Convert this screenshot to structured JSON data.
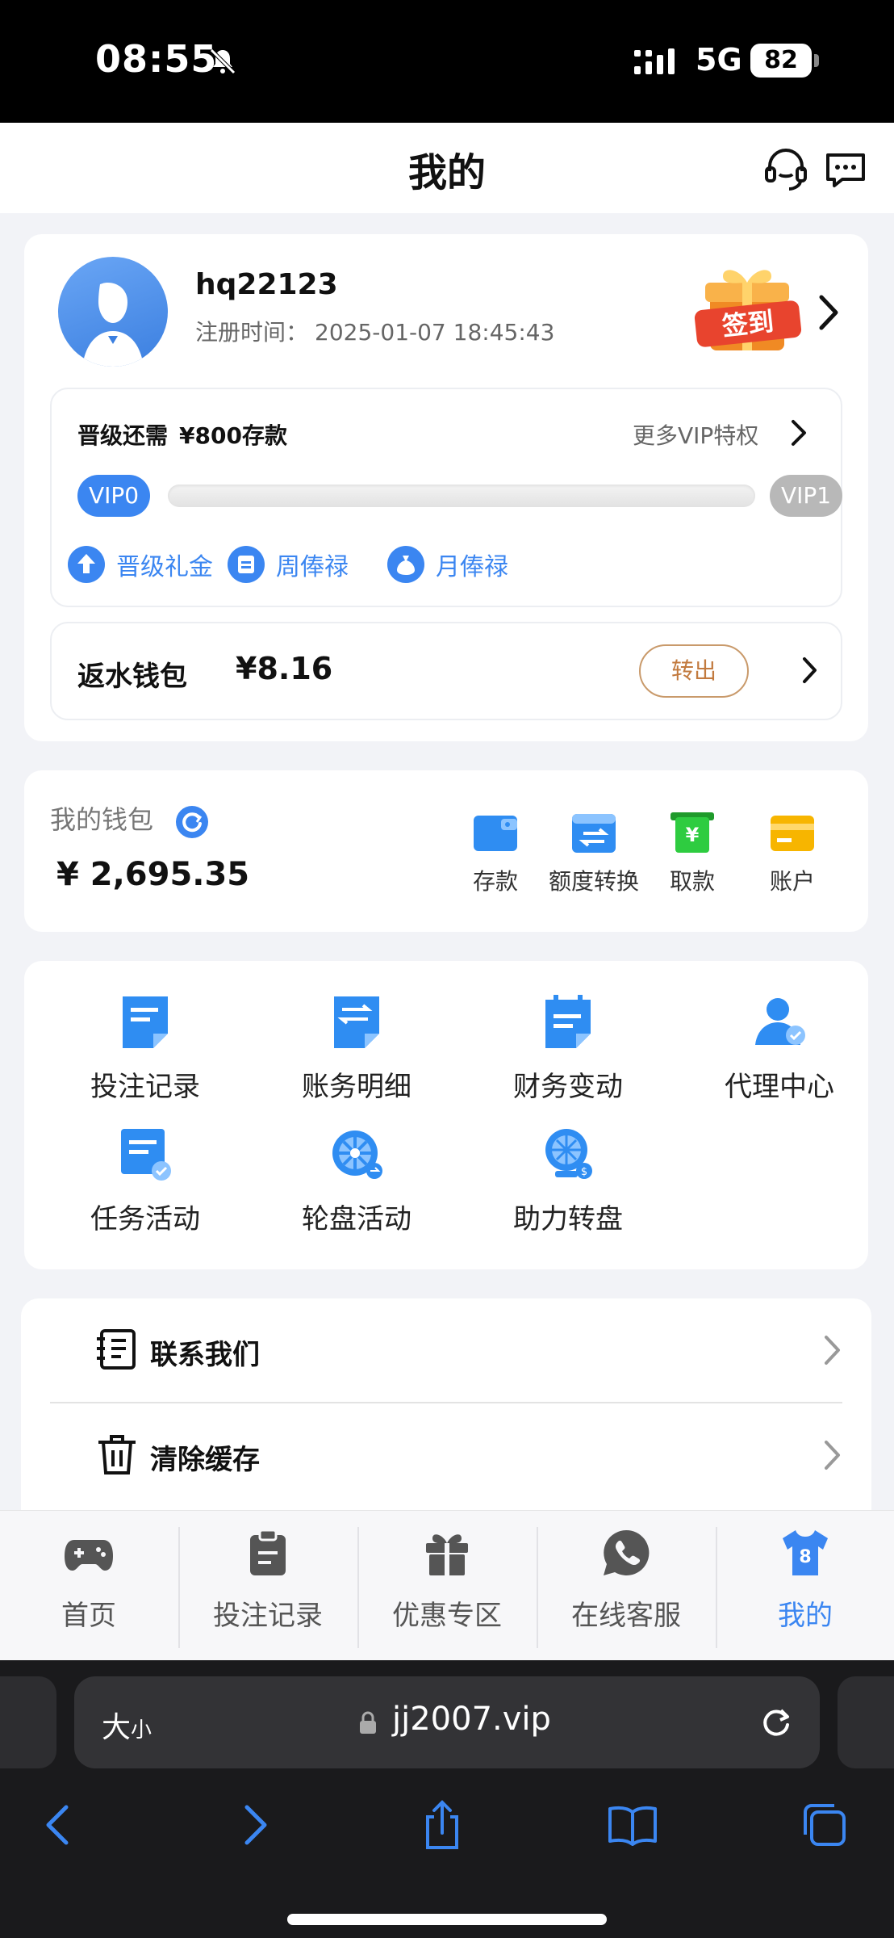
{
  "status_bar": {
    "time": "08:55",
    "network": "5G",
    "battery": "82"
  },
  "header": {
    "title": "我的"
  },
  "user": {
    "username": "hq22123",
    "reg_label": "注册时间：",
    "reg_time": "2025-01-07 18:45:43",
    "signin_label": "签到"
  },
  "vip": {
    "upgrade_need_label": "晋级还需",
    "upgrade_need_amount": "¥800存款",
    "more_label": "更多VIP特权",
    "from_level": "VIP0",
    "to_level": "VIP1",
    "progress": 0,
    "perks": [
      "晋级礼金",
      "周俸禄",
      "月俸禄"
    ]
  },
  "rebate": {
    "label": "返水钱包",
    "amount": "¥8.16",
    "button": "转出"
  },
  "wallet": {
    "title": "我的钱包",
    "amount": "¥  2,695.35",
    "actions": [
      "存款",
      "额度转换",
      "取款",
      "账户"
    ]
  },
  "functions": [
    "投注记录",
    "账务明细",
    "财务变动",
    "代理中心",
    "任务活动",
    "轮盘活动",
    "助力转盘"
  ],
  "list": [
    "联系我们",
    "清除缓存"
  ],
  "tabbar": {
    "tabs": [
      "首页",
      "投注记录",
      "优惠专区",
      "在线客服",
      "我的"
    ],
    "active_index": 4,
    "active_badge": "8"
  },
  "browser": {
    "size_label": "大",
    "size_label_small": "小",
    "url": "jj2007.vip"
  },
  "colors": {
    "accent": "#3b86f1",
    "rebate_button": "#c27a3e",
    "wallet_green": "#2ecc40",
    "wallet_yellow": "#f7b500"
  }
}
